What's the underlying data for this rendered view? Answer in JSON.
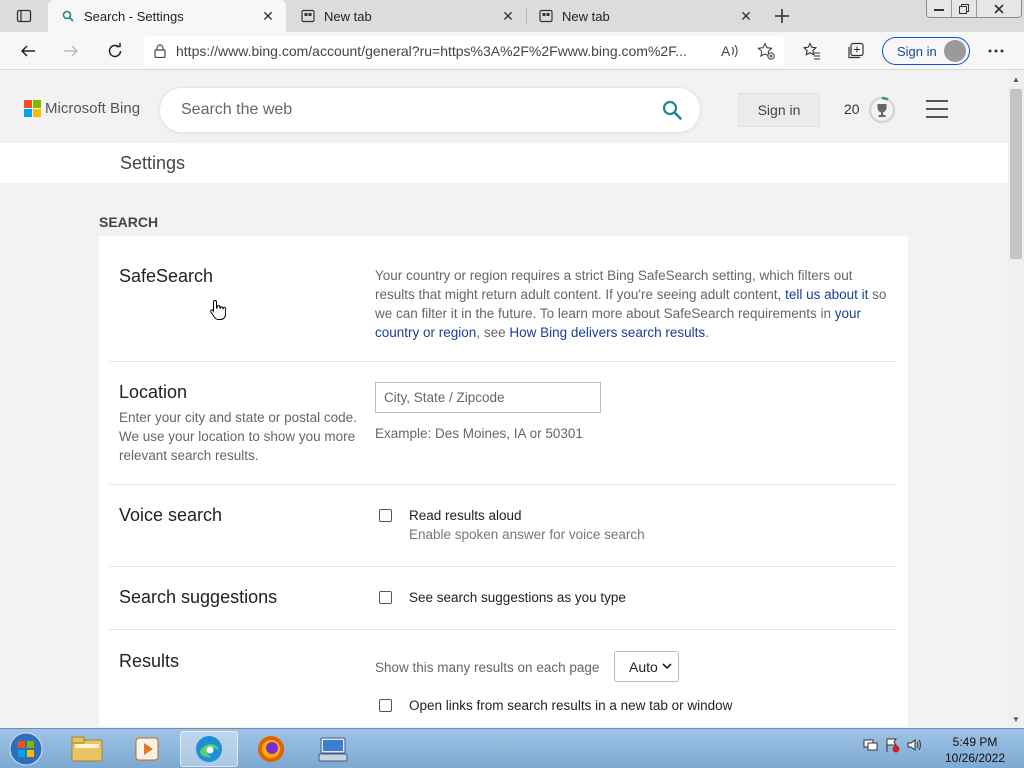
{
  "browser": {
    "tabs": [
      {
        "title": "Search - Settings",
        "active": true
      },
      {
        "title": "New tab",
        "active": false
      },
      {
        "title": "New tab",
        "active": false
      }
    ],
    "url": "https://www.bing.com/account/general?ru=https%3A%2F%2Fwww.bing.com%2F...",
    "signin_label": "Sign in"
  },
  "header": {
    "logo_text": "Microsoft Bing",
    "search_placeholder": "Search the web",
    "signin_label": "Sign in",
    "rewards_count": "20"
  },
  "settings_title": "Settings",
  "section_label": "SEARCH",
  "safesearch": {
    "title": "SafeSearch",
    "text1": "Your country or region requires a strict Bing SafeSearch setting, which filters out results that might return adult content. If you're seeing adult content, ",
    "link1": "tell us about it",
    "text2": " so we can filter it in the future. To learn more about SafeSearch requirements in ",
    "link2": "your country or region",
    "text3": ", see ",
    "link3": "How Bing delivers search results",
    "text4": "."
  },
  "location": {
    "title": "Location",
    "description": "Enter your city and state or postal code. We use your location to show you more relevant search results.",
    "placeholder": "City, State / Zipcode",
    "example": "Example: Des Moines, IA or 50301"
  },
  "voice": {
    "title": "Voice search",
    "option_label": "Read results aloud",
    "option_sub": "Enable spoken answer for voice search",
    "checked": false
  },
  "suggestions": {
    "title": "Search suggestions",
    "option_label": "See search suggestions as you type",
    "checked": false
  },
  "results": {
    "title": "Results",
    "count_label": "Show this many results on each page",
    "count_value": "Auto",
    "newtab_label": "Open links from search results in a new tab or window",
    "newtab_checked": false
  },
  "taskbar": {
    "time": "5:49 PM",
    "date": "10/26/2022"
  },
  "colors": {
    "link": "#1a3f96",
    "search_icon": "#178b8b",
    "taskbar": "#8fb6dc"
  }
}
